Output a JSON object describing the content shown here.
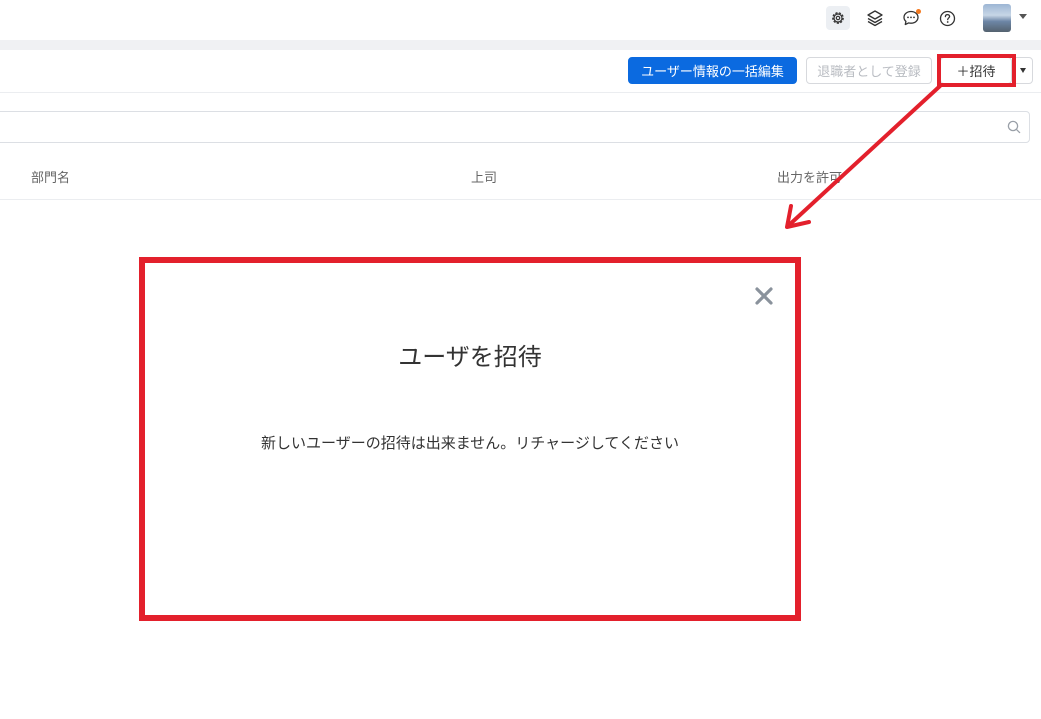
{
  "header": {
    "icons": [
      "gear-icon",
      "layers-icon",
      "chat-icon",
      "help-icon"
    ],
    "notification_color": "#f4791f"
  },
  "toolbar": {
    "bulk_edit_label": "ユーザー情報の一括編集",
    "register_retired_label": "退職者として登録",
    "invite_label": "＋招待"
  },
  "search": {
    "placeholder": ""
  },
  "table": {
    "columns": [
      "部門名",
      "上司",
      "出力を許可"
    ]
  },
  "modal": {
    "title": "ユーザを招待",
    "message": "新しいユーザーの招待は出来ません。リチャージしてください"
  },
  "colors": {
    "primary": "#0b6ae0",
    "annotation": "#e3202c"
  }
}
